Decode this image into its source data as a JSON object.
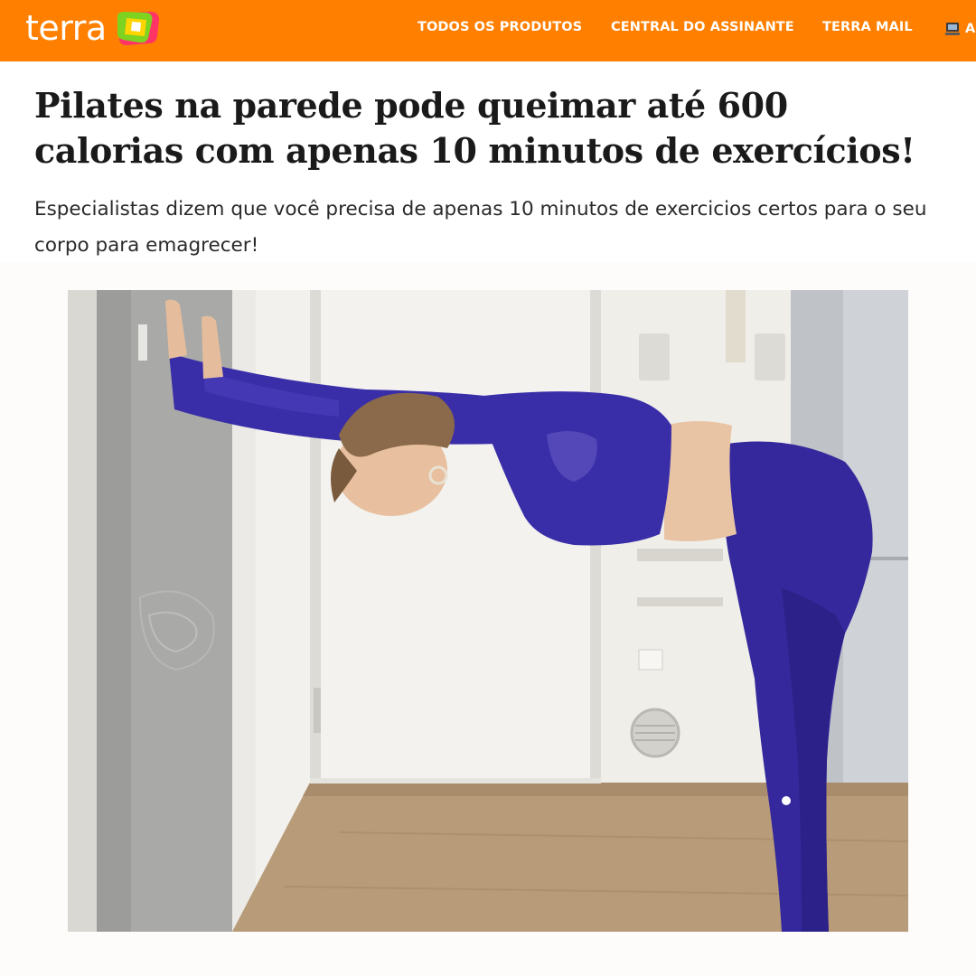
{
  "header": {
    "logo_text": "terra",
    "brand_color": "#ff7f00",
    "nav": [
      {
        "label": "TODOS OS PRODUTOS"
      },
      {
        "label": "CENTRAL DO ASSINANTE"
      },
      {
        "label": "TERRA MAIL"
      }
    ],
    "more": {
      "icon": "computer-icon",
      "label": "A"
    }
  },
  "article": {
    "headline": "Pilates na parede pode queimar até 600 calorias com apenas 10 minutos de exercícios!",
    "subtitle": "Especialistas dizem que você precisa de apenas 10 minutos de exercicios certos para o seu corpo para emagrecer!"
  },
  "photo": {
    "subject": "woman-wall-stretch",
    "outfit_color": "#3a2ea8"
  }
}
